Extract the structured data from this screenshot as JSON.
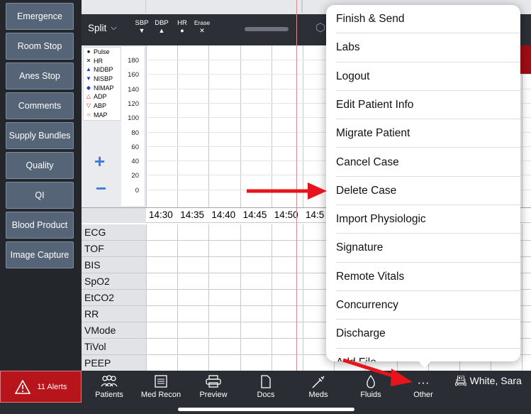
{
  "sidebar": {
    "items": [
      {
        "label": "Emergence"
      },
      {
        "label": "Room Stop"
      },
      {
        "label": "Anes Stop"
      },
      {
        "label": "Comments"
      },
      {
        "label": "Supply Bundles"
      },
      {
        "label": "Quality"
      },
      {
        "label": "QI"
      },
      {
        "label": "Blood Product"
      },
      {
        "label": "Image Capture"
      }
    ]
  },
  "toolbar": {
    "split_label": "Split",
    "sbp_label": "SBP",
    "dbp_label": "DBP",
    "hr_label": "HR",
    "erase_label": "Erase"
  },
  "legend": [
    {
      "marker": "●",
      "label": "Pulse",
      "color": "#000000"
    },
    {
      "marker": "✕",
      "label": "HR",
      "color": "#000000"
    },
    {
      "marker": "▲",
      "label": "NIDBP",
      "color": "#1a3fbf"
    },
    {
      "marker": "▼",
      "label": "NISBP",
      "color": "#1a3fbf"
    },
    {
      "marker": "◆",
      "label": "NIMAP",
      "color": "#1a3fbf"
    },
    {
      "marker": "△",
      "label": "ADP",
      "color": "#d41f1f"
    },
    {
      "marker": "▽",
      "label": "ABP",
      "color": "#d41f1f"
    },
    {
      "marker": "○",
      "label": "MAP",
      "color": "#d41f1f"
    }
  ],
  "yaxis_ticks": [
    "180",
    "160",
    "140",
    "120",
    "100",
    "80",
    "60",
    "40",
    "20",
    "0"
  ],
  "plus_label": "+",
  "minus_label": "−",
  "times": [
    "14:30",
    "14:35",
    "14:40",
    "14:45",
    "14:50",
    "14:5"
  ],
  "parameters": [
    "ECG",
    "TOF",
    "BIS",
    "SpO2",
    "EtCO2",
    "RR",
    "VMode",
    "TiVol",
    "PEEP"
  ],
  "menu": {
    "items": [
      {
        "label": "Finish & Send"
      },
      {
        "label": "Labs"
      },
      {
        "label": "Logout"
      },
      {
        "label": "Edit Patient Info"
      },
      {
        "label": "Migrate Patient"
      },
      {
        "label": "Cancel Case"
      },
      {
        "label": "Delete Case"
      },
      {
        "label": "Import Physiologic"
      },
      {
        "label": "Signature"
      },
      {
        "label": "Remote Vitals"
      },
      {
        "label": "Concurrency"
      },
      {
        "label": "Discharge"
      },
      {
        "label": "Add File"
      }
    ]
  },
  "bottombar": {
    "alerts_label": "11 Alerts",
    "tabs": [
      {
        "label": "Patients",
        "icon": "patients-icon"
      },
      {
        "label": "Med Recon",
        "icon": "med-recon-icon"
      },
      {
        "label": "Preview",
        "icon": "printer-icon"
      },
      {
        "label": "Docs",
        "icon": "document-icon"
      },
      {
        "label": "Meds",
        "icon": "syringe-icon"
      },
      {
        "label": "Fluids",
        "icon": "drop-icon"
      },
      {
        "label": "Other",
        "icon": "ellipsis-icon"
      }
    ],
    "user_name": "White, Sara"
  },
  "colors": {
    "sidebar_button": "#566477",
    "accent_blue": "#3d7bd9",
    "alert_red": "#b8141b",
    "annotation_arrow": "#e8141b"
  }
}
